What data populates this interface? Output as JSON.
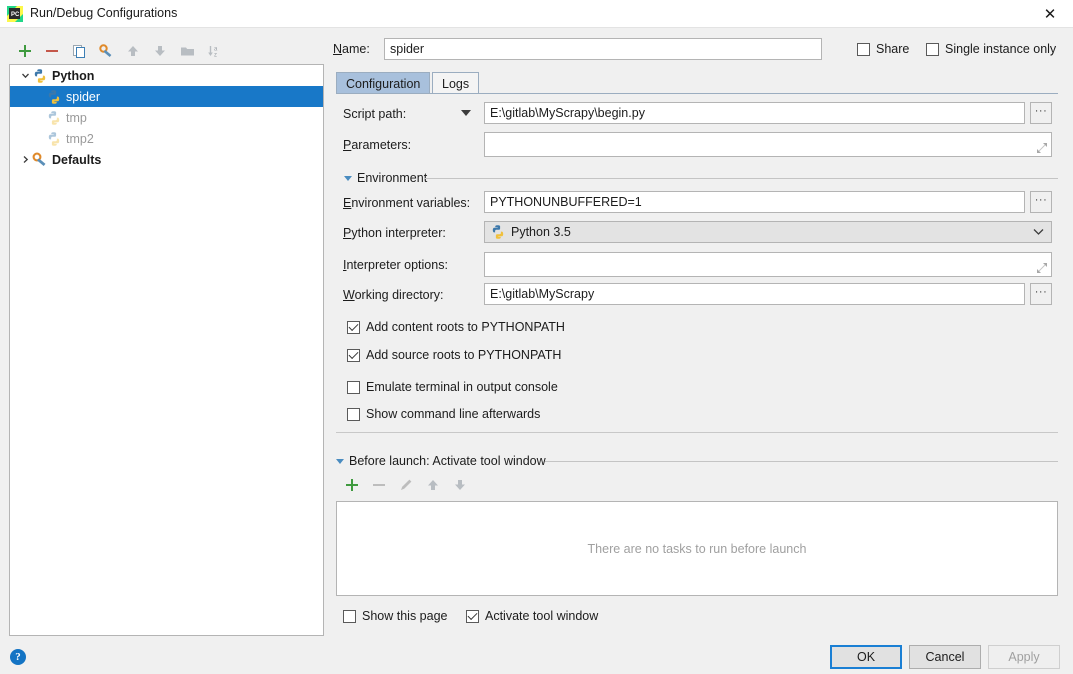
{
  "window": {
    "title": "Run/Debug Configurations",
    "app_icon": "pycharm-logo-icon",
    "close_label": "✕"
  },
  "tree_toolbar": {
    "buttons": [
      {
        "name": "add-configuration-button",
        "icon": "plus-icon",
        "enabled": true
      },
      {
        "name": "remove-configuration-button",
        "icon": "minus-icon",
        "enabled": true
      },
      {
        "name": "copy-configuration-button",
        "icon": "copy-icon",
        "enabled": true
      },
      {
        "name": "edit-defaults-button",
        "icon": "wrench-icon",
        "enabled": true
      },
      {
        "name": "move-up-button",
        "icon": "arrow-up-icon",
        "enabled": false
      },
      {
        "name": "move-down-button",
        "icon": "arrow-down-icon",
        "enabled": false
      },
      {
        "name": "new-folder-button",
        "icon": "folder-icon",
        "enabled": false
      },
      {
        "name": "sort-alphabetically-button",
        "icon": "sort-az-icon",
        "enabled": false
      }
    ]
  },
  "tree": {
    "items": [
      {
        "label": "Python",
        "icon": "python-icon",
        "level": 0,
        "bold": true,
        "expanded": true,
        "selected": false,
        "muted": false
      },
      {
        "label": "spider",
        "icon": "python-icon",
        "level": 1,
        "bold": false,
        "expanded": null,
        "selected": true,
        "muted": false
      },
      {
        "label": "tmp",
        "icon": "python-icon-faded",
        "level": 1,
        "bold": false,
        "expanded": null,
        "selected": false,
        "muted": true
      },
      {
        "label": "tmp2",
        "icon": "python-icon-faded",
        "level": 1,
        "bold": false,
        "expanded": null,
        "selected": false,
        "muted": true
      },
      {
        "label": "Defaults",
        "icon": "wrench-icon",
        "level": 0,
        "bold": true,
        "expanded": false,
        "selected": false,
        "muted": false
      }
    ]
  },
  "header": {
    "name_label": "Name:",
    "name_mnemonic": "N",
    "name_value": "spider",
    "share_label": "Share",
    "share_checked": false,
    "single_instance_label": "Single instance only",
    "single_instance_checked": false
  },
  "tabs": [
    {
      "label": "Configuration",
      "active": true
    },
    {
      "label": "Logs",
      "active": false
    }
  ],
  "configuration": {
    "script_path_label": "Script path:",
    "script_path_value": "E:\\gitlab\\MyScrapy\\begin.py",
    "parameters_label": "Parameters:",
    "parameters_value": "",
    "environment_section_label": "Environment",
    "environment_variables_label": "Environment variables:",
    "environment_variables_value": "PYTHONUNBUFFERED=1",
    "python_interpreter_label": "Python interpreter:",
    "python_interpreter_value": "Python 3.5",
    "interpreter_options_label": "Interpreter options:",
    "interpreter_options_value": "",
    "working_directory_label": "Working directory:",
    "working_directory_value": "E:\\gitlab\\MyScrapy",
    "checkboxes": [
      {
        "label": "Add content roots to PYTHONPATH",
        "checked": true
      },
      {
        "label": "Add source roots to PYTHONPATH",
        "checked": true
      },
      {
        "label": "Emulate terminal in output console",
        "checked": false
      },
      {
        "label": "Show command line afterwards",
        "checked": false
      }
    ],
    "browse_button_label": "···"
  },
  "before_launch": {
    "section_label": "Before launch: Activate tool window",
    "toolbar": [
      {
        "name": "add-task-button",
        "icon": "plus-icon",
        "enabled": true
      },
      {
        "name": "remove-task-button",
        "icon": "minus-icon",
        "enabled": false
      },
      {
        "name": "edit-task-button",
        "icon": "pencil-icon",
        "enabled": false
      },
      {
        "name": "move-task-up-button",
        "icon": "arrow-up-icon",
        "enabled": false
      },
      {
        "name": "move-task-down-button",
        "icon": "arrow-down-icon",
        "enabled": false
      }
    ],
    "empty_text": "There are no tasks to run before launch",
    "show_this_page_label": "Show this page",
    "show_this_page_checked": false,
    "activate_tool_window_label": "Activate tool window",
    "activate_tool_window_checked": true
  },
  "footer": {
    "help_label": "?",
    "ok_label": "OK",
    "cancel_label": "Cancel",
    "apply_label": "Apply",
    "apply_enabled": false
  },
  "colors": {
    "selection_blue": "#1878c8",
    "tab_active": "#a8c0dc",
    "focus_blue": "#1a7fd4",
    "help_blue": "#1474c4",
    "plus_green": "#3f9a3f",
    "minus_red": "#c4574a",
    "dialog_bg": "#f0f0f0"
  }
}
